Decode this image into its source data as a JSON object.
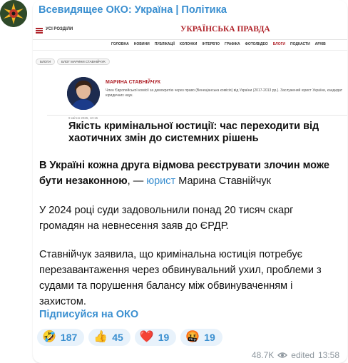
{
  "channel": {
    "name": "Всевидящее ОКО: Україна | Політика"
  },
  "preview": {
    "sections_label": "УСІ РОЗДІЛИ",
    "site_logo": "УКРАЇНСЬКА ПРАВДА",
    "nav": [
      "ГОЛОВНА",
      "НОВИНИ",
      "ПУБЛІКАЦІЇ",
      "КОЛОНКИ",
      "ІНТЕРВ'Ю",
      "ГРАФІКА",
      "ФОТО/ВІДЕО",
      "БЛОГИ",
      "ПОДКАСТИ",
      "АРХІВ"
    ],
    "nav_active": "БЛОГИ",
    "breadcrumb_1": "БЛОГИ",
    "breadcrumb_2": "БЛОГ МАРИНИ СТАВНІЙЧУК",
    "author_name": "МАРИНА СТАВНІЙЧУК",
    "author_bio": "Член Європейської комісії за демократію через право (Венеціанська комісія) від України (2017-2013 рр.). Заслужений юрист України, кандидат юридичних наук.",
    "article_date": "9 квітня 2025, 10:15",
    "article_title": "Якість кримінальної юстиції: час переходити від хаотичних змін до системних рішень"
  },
  "message": {
    "p1_bold": "В Україні кожна друга відмова реєструвати злочин може бути незаконною",
    "p1_sep": ", — ",
    "p1_link": "юрист",
    "p1_rest": " Марина Ставнійчук",
    "p2": "У 2024 році суди задовольнили понад 20 тисяч скарг громадян на невнесення заяв до ЄРДР.",
    "p3": "Ставнійчук заявила, що кримінальна юстиція потребує перезавантаження через обвинувальний ухил, проблеми з судами та порушення балансу між обвинуваченням і захистом.",
    "subscribe": "Підписуйся на ОКО"
  },
  "reactions": [
    {
      "emoji": "🤣",
      "count": "187"
    },
    {
      "emoji": "👍",
      "count": "45"
    },
    {
      "emoji": "❤️",
      "count": "19"
    },
    {
      "emoji": "🤬",
      "count": "19"
    }
  ],
  "meta": {
    "views": "48.7K",
    "edited": "edited",
    "time": "13:58"
  },
  "colors": {
    "accent": "#3a8fd0",
    "brand": "#b0232a",
    "reaction_bg": "#e8f2fb",
    "meta": "#8d969d"
  }
}
